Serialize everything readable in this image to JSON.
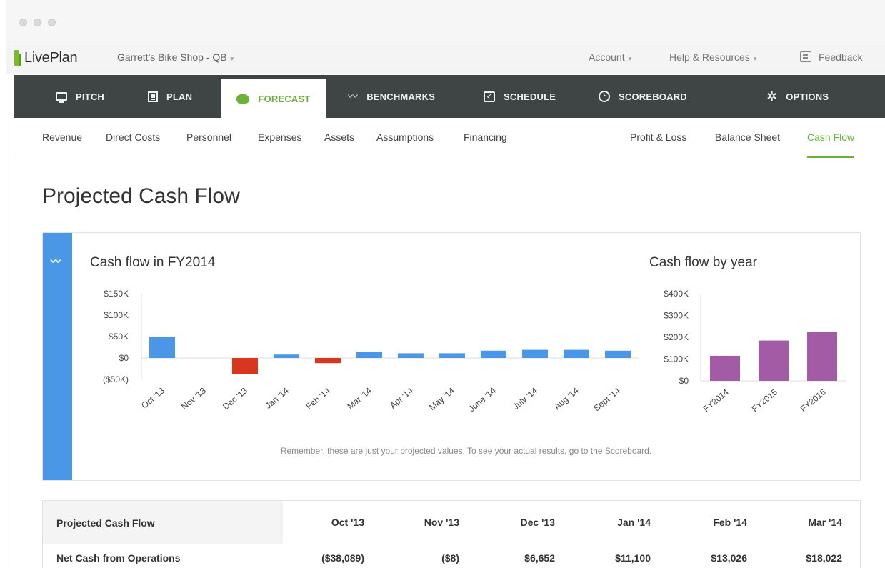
{
  "app": {
    "logo_text": "LivePlan",
    "company": "Garrett's Bike Shop - QB",
    "account": "Account",
    "help": "Help & Resources",
    "feedback": "Feedback"
  },
  "main_nav": [
    {
      "label": "PITCH",
      "icon": "monitor-icon"
    },
    {
      "label": "PLAN",
      "icon": "document-icon"
    },
    {
      "label": "FORECAST",
      "icon": "piggy-bank-icon",
      "active": true
    },
    {
      "label": "BENCHMARKS",
      "icon": "trend-line-icon"
    },
    {
      "label": "SCHEDULE",
      "icon": "checkbox-icon"
    },
    {
      "label": "SCOREBOARD",
      "icon": "gauge-icon"
    },
    {
      "label": "OPTIONS",
      "icon": "gear-icon"
    }
  ],
  "sub_nav": {
    "left": [
      "Revenue",
      "Direct Costs",
      "Personnel",
      "Expenses",
      "Assets",
      "Assumptions",
      "Financing"
    ],
    "right": [
      "Profit & Loss",
      "Balance Sheet",
      "Cash Flow"
    ],
    "active": "Cash Flow"
  },
  "page_title": "Projected Cash Flow",
  "colors": {
    "accent_green": "#6ab23a",
    "bar_blue": "#4a97e8",
    "bar_red": "#d9361f",
    "bar_purple": "#a45ba6",
    "nav_dark": "#3f4444"
  },
  "chart_data": [
    {
      "type": "bar",
      "title": "Cash flow in FY2014",
      "categories": [
        "Oct '13",
        "Nov '13",
        "Dec '13",
        "Jan '14",
        "Feb '14",
        "Mar '14",
        "Apr '14",
        "May '14",
        "June '14",
        "July '14",
        "Aug '14",
        "Sept '14"
      ],
      "values": [
        50000,
        0,
        -38000,
        8000,
        -12000,
        15000,
        11000,
        11000,
        17000,
        19000,
        19000,
        17000
      ],
      "yticks": [
        "$150K",
        "$100K",
        "$50K",
        "$0",
        "($50K)"
      ],
      "ylim": [
        -50000,
        150000
      ],
      "grid": false,
      "legend": "none"
    },
    {
      "type": "bar",
      "title": "Cash flow by year",
      "categories": [
        "FY2014",
        "FY2015",
        "FY2016"
      ],
      "values": [
        115000,
        185000,
        225000
      ],
      "yticks": [
        "$400K",
        "$300K",
        "$200K",
        "$100K",
        "$0"
      ],
      "ylim": [
        0,
        400000
      ],
      "grid": false,
      "legend": "none"
    }
  ],
  "disclaimer": "Remember, these are just your projected values. To see your actual results, go to the Scoreboard.",
  "table": {
    "header": {
      "label": "Projected Cash Flow",
      "columns": [
        "Oct '13",
        "Nov '13",
        "Dec '13",
        "Jan '14",
        "Feb '14",
        "Mar '14"
      ]
    },
    "rows": [
      {
        "label": "Net Cash from Operations",
        "values": [
          "($38,089)",
          "($8)",
          "$6,652",
          "$11,100",
          "$13,026",
          "$18,022"
        ]
      }
    ]
  }
}
